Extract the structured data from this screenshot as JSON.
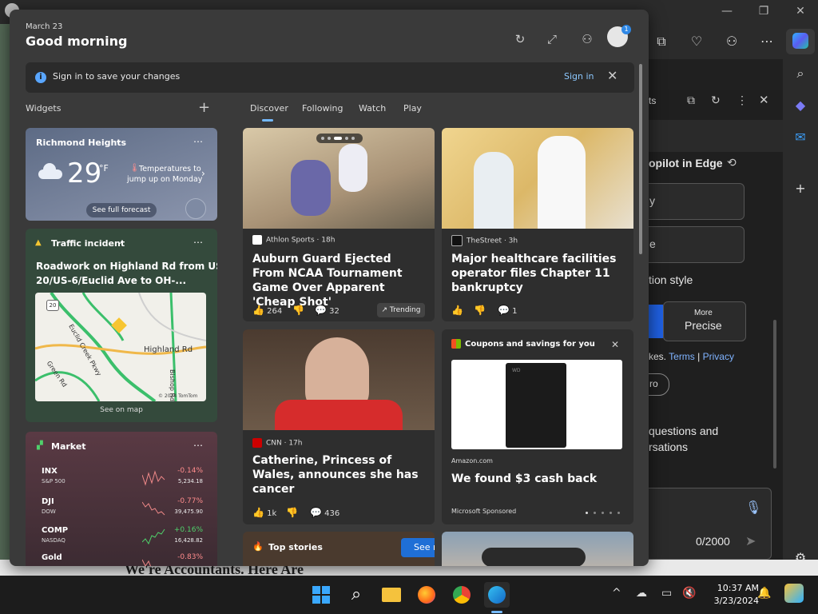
{
  "header": {
    "date": "March 23",
    "greeting": "Good morning"
  },
  "signin": {
    "message": "Sign in to save your changes",
    "link": "Sign in"
  },
  "widgets": {
    "label": "Widgets"
  },
  "tabs": [
    {
      "label": "Discover"
    },
    {
      "label": "Following"
    },
    {
      "label": "Watch"
    },
    {
      "label": "Play"
    }
  ],
  "weather": {
    "location": "Richmond Heights",
    "temp": "29",
    "unit": "°F",
    "alert_line1": "Temperatures to",
    "alert_line2": "jump up on Monday",
    "forecast_btn": "See full forecast"
  },
  "traffic": {
    "title": "Traffic incident",
    "headline_line1": "Roadwork on Highland Rd from US-",
    "headline_line2": "20/US-6/Euclid Ave to OH-...",
    "map_road1": "Highland Rd",
    "map_road2": "Euclid Creek Pkwy",
    "map_road3": "Green Rd",
    "map_road4": "Bishop Rd",
    "map_shield": "20",
    "map_credit": "© 2024 TomTom",
    "see_map": "See on map"
  },
  "market": {
    "title": "Market",
    "rows": [
      {
        "symbol": "INX",
        "name": "S&P 500",
        "change": "-0.14%",
        "value": "5,234.18",
        "up": false
      },
      {
        "symbol": "DJI",
        "name": "DOW",
        "change": "-0.77%",
        "value": "39,475.90",
        "up": false
      },
      {
        "symbol": "COMP",
        "name": "NASDAQ",
        "change": "+0.16%",
        "value": "16,428.82",
        "up": true
      },
      {
        "symbol": "Gold",
        "name": "",
        "change": "-0.83%",
        "value": "",
        "up": false
      }
    ]
  },
  "news": [
    {
      "source": "Athlon Sports · 18h",
      "title": "Auburn Guard Ejected From NCAA Tournament Game Over Apparent 'Cheap Shot'",
      "likes": "264",
      "comments": "32",
      "badge": "Trending"
    },
    {
      "source": "TheStreet · 3h",
      "title": "Major healthcare facilities operator files Chapter 11 bankruptcy",
      "likes": "",
      "comments": "1",
      "badge": ""
    },
    {
      "source": "CNN · 17h",
      "title": "Catherine, Princess of Wales, announces she has cancer",
      "likes": "1k",
      "comments": "436",
      "badge": ""
    }
  ],
  "coupon": {
    "header": "Coupons and savings for you",
    "store": "Amazon.com",
    "title": "We found $3 cash back",
    "sponsor": "Microsoft Sponsored",
    "product_logo": "WD"
  },
  "top_stories": {
    "label": "Top stories",
    "see_more": "See more"
  },
  "bottom_headline": "We're Accountants. Here Are",
  "copilot": {
    "title_partial": "opilot in Edge",
    "tab_partial": "ts",
    "opt1": "y",
    "opt2": "e",
    "style_label": "tion style",
    "more_label": "More",
    "precise_label": "Precise",
    "terms_prefix": "kes.",
    "terms": "Terms",
    "sep": "|",
    "privacy": "Privacy",
    "pro": "ro",
    "q1": "questions and",
    "q2": "rsations",
    "counter": "0/2000"
  },
  "taskbar": {
    "time": "10:37 AM",
    "date": "3/23/2024",
    "avatar_badge": "1"
  },
  "colors": {
    "accent": "#74b9ff",
    "positive": "#4fd16b",
    "negative": "#ff8c8c",
    "see_more_bg": "#1f6fd6"
  }
}
